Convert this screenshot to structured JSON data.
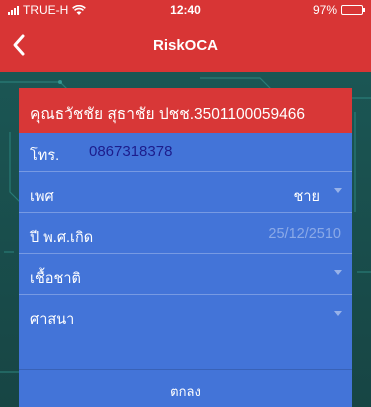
{
  "status_bar": {
    "carrier": "TRUE-H",
    "time": "12:40",
    "battery": "97%",
    "battery_level": 0.97
  },
  "nav": {
    "title": "RiskOCA",
    "back_icon": "chevron-left-icon"
  },
  "colors": {
    "accent_red": "#d83535",
    "card_blue": "#4374d8",
    "phone_text": "#1d1d8c"
  },
  "form": {
    "header": "คุณธวัชชัย สุธาชัย ปชช.3501100059466",
    "phone_label": "โทร.",
    "phone_value": "0867318378",
    "gender_label": "เพศ",
    "gender_value": "ชาย",
    "birth_year_label": "ปี พ.ศ.เกิด",
    "birth_year_placeholder": "25/12/2510",
    "nationality_label": "เชื้อชาติ",
    "religion_label": "ศาสนา",
    "submit_label": "ตกลง"
  }
}
